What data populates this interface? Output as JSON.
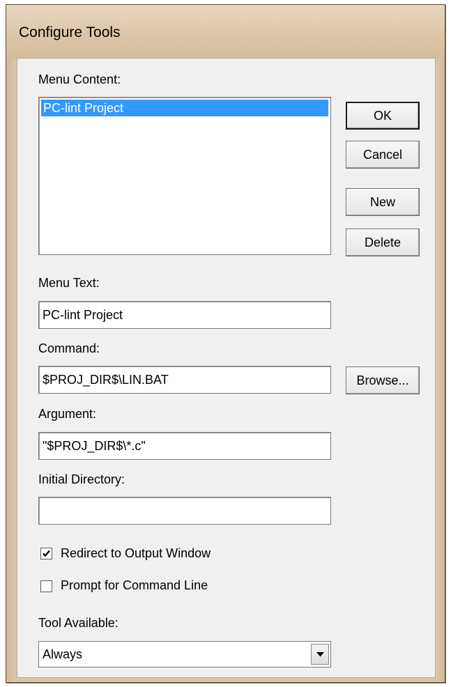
{
  "window": {
    "title": "Configure Tools"
  },
  "menu_content": {
    "label": "Menu Content:",
    "items": [
      "PC-lint Project"
    ],
    "selected_index": 0
  },
  "buttons": {
    "ok": "OK",
    "cancel": "Cancel",
    "new": "New",
    "delete": "Delete",
    "browse": "Browse..."
  },
  "menu_text": {
    "label": "Menu Text:",
    "value": "PC-lint Project"
  },
  "command": {
    "label": "Command:",
    "value": "$PROJ_DIR$\\LIN.BAT"
  },
  "argument": {
    "label": "Argument:",
    "value": "\"$PROJ_DIR$\\*.c\""
  },
  "initial_directory": {
    "label": "Initial Directory:",
    "value": ""
  },
  "redirect_output": {
    "label": "Redirect to Output Window",
    "checked": true
  },
  "prompt_command_line": {
    "label": "Prompt for Command Line",
    "checked": false
  },
  "tool_available": {
    "label": "Tool Available:",
    "selected": "Always"
  },
  "colors": {
    "selection": "#3399ff",
    "frame": "#d9c6ab",
    "client": "#f0f0f0"
  },
  "icons": {
    "checkmark": "checkmark-icon",
    "dropdown": "chevron-down-icon"
  }
}
